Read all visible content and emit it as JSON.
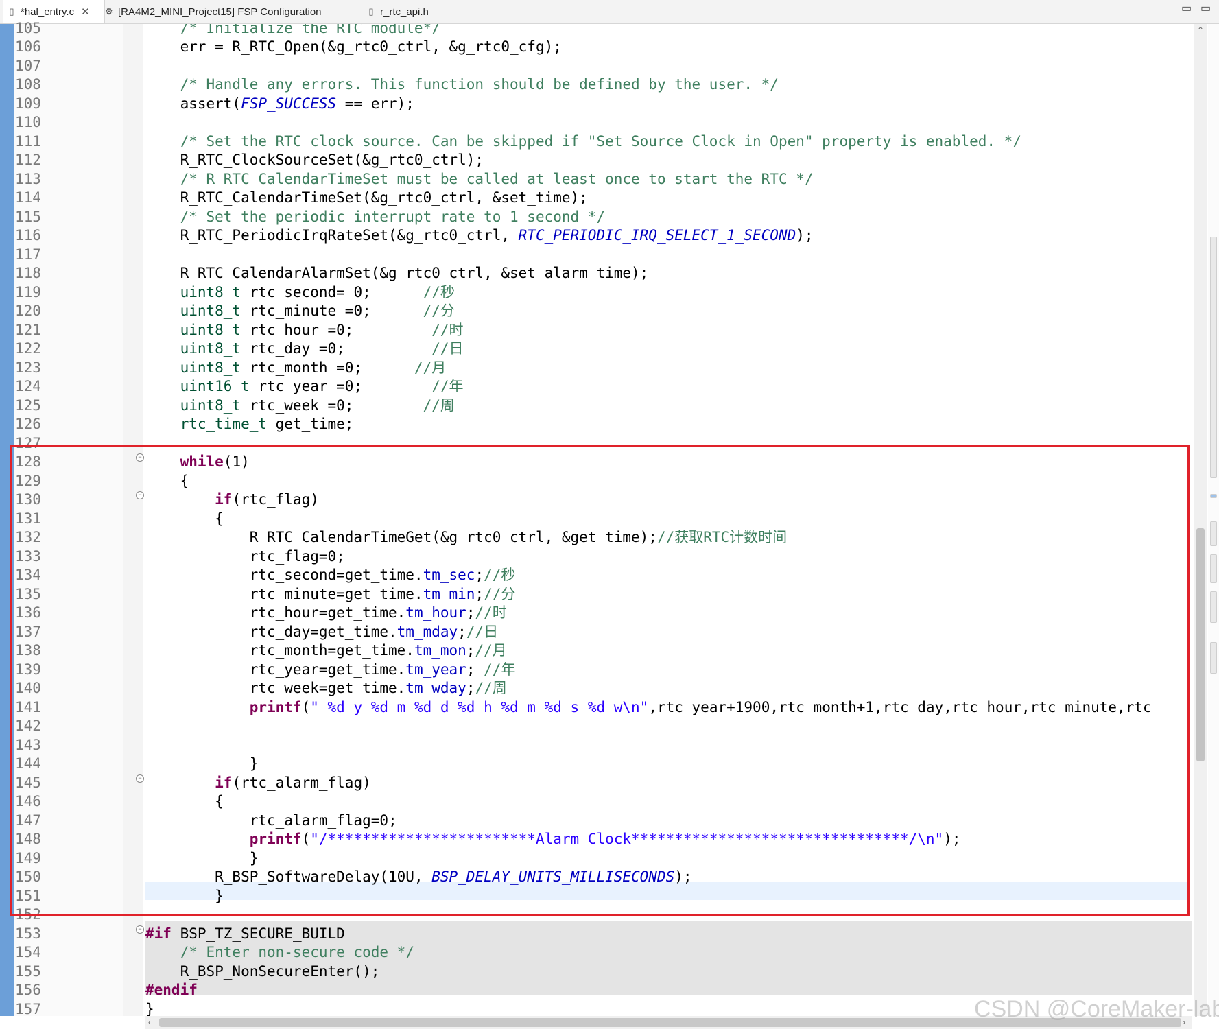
{
  "tabs": [
    {
      "label": "*hal_entry.c",
      "icon": "c-file-icon",
      "active": true
    },
    {
      "label": "[RA4M2_MINI_Project15] FSP Configuration",
      "icon": "gear-icon",
      "active": false
    },
    {
      "label": "r_rtc_api.h",
      "icon": "h-file-icon",
      "active": false
    }
  ],
  "window_controls": {
    "minimize": "▭",
    "maximize": "▭"
  },
  "editor": {
    "line_numbers": [
      "105",
      "106",
      "107",
      "108",
      "109",
      "110",
      "111",
      "112",
      "113",
      "114",
      "115",
      "116",
      "117",
      "118",
      "119",
      "120",
      "121",
      "122",
      "123",
      "124",
      "125",
      "126",
      "127",
      "128",
      "129",
      "130",
      "131",
      "132",
      "133",
      "134",
      "135",
      "136",
      "137",
      "138",
      "139",
      "140",
      "141",
      "142",
      "143",
      "144",
      "145",
      "146",
      "147",
      "148",
      "149",
      "150",
      "151",
      "152",
      "153",
      "154",
      "155",
      "156",
      "157"
    ],
    "lines": [
      [
        [
          "cm",
          "    /* Initialize the RTC module*/"
        ]
      ],
      [
        [
          "",
          "    err = R_RTC_Open(&g_rtc0_ctrl, &g_rtc0_cfg);"
        ]
      ],
      [],
      [
        [
          "cm",
          "    /* Handle any errors. This function should be defined by the user. */"
        ]
      ],
      [
        [
          "",
          "    assert("
        ],
        [
          "mc",
          "FSP_SUCCESS"
        ],
        [
          "",
          " == err);"
        ]
      ],
      [],
      [
        [
          "cm",
          "    /* Set the RTC clock source. Can be skipped if \"Set Source Clock in Open\" property is enabled. */"
        ]
      ],
      [
        [
          "",
          "    R_RTC_ClockSourceSet(&g_rtc0_ctrl);"
        ]
      ],
      [
        [
          "cm",
          "    /* R_RTC_CalendarTimeSet must be called at least once to start the RTC */"
        ]
      ],
      [
        [
          "",
          "    R_RTC_CalendarTimeSet(&g_rtc0_ctrl, &set_time);"
        ]
      ],
      [
        [
          "cm",
          "    /* Set the periodic interrupt rate to 1 second */"
        ]
      ],
      [
        [
          "",
          "    R_RTC_PeriodicIrqRateSet(&g_rtc0_ctrl, "
        ],
        [
          "mc",
          "RTC_PERIODIC_IRQ_SELECT_1_SECOND"
        ],
        [
          "",
          ");"
        ]
      ],
      [],
      [
        [
          "",
          "    R_RTC_CalendarAlarmSet(&g_rtc0_ctrl, &set_alarm_time);"
        ]
      ],
      [
        [
          "ty",
          "    uint8_t"
        ],
        [
          "",
          " rtc_second= 0;      "
        ],
        [
          "cm",
          "//秒"
        ]
      ],
      [
        [
          "ty",
          "    uint8_t"
        ],
        [
          "",
          " rtc_minute =0;      "
        ],
        [
          "cm",
          "//分"
        ]
      ],
      [
        [
          "ty",
          "    uint8_t"
        ],
        [
          "",
          " rtc_hour =0;         "
        ],
        [
          "cm",
          "//时"
        ]
      ],
      [
        [
          "ty",
          "    uint8_t"
        ],
        [
          "",
          " rtc_day =0;          "
        ],
        [
          "cm",
          "//日"
        ]
      ],
      [
        [
          "ty",
          "    uint8_t"
        ],
        [
          "",
          " rtc_month =0;      "
        ],
        [
          "cm",
          "//月"
        ]
      ],
      [
        [
          "ty",
          "    uint16_t"
        ],
        [
          "",
          " rtc_year =0;        "
        ],
        [
          "cm",
          "//年"
        ]
      ],
      [
        [
          "ty",
          "    uint8_t"
        ],
        [
          "",
          " rtc_week =0;        "
        ],
        [
          "cm",
          "//周"
        ]
      ],
      [
        [
          "ty",
          "    rtc_time_t"
        ],
        [
          "",
          " get_time;"
        ]
      ],
      [],
      [
        [
          "kw",
          "    while"
        ],
        [
          "",
          "(1)"
        ]
      ],
      [
        [
          "",
          "    {"
        ]
      ],
      [
        [
          "kw",
          "        if"
        ],
        [
          "",
          "(rtc_flag)"
        ]
      ],
      [
        [
          "",
          "        {"
        ]
      ],
      [
        [
          "",
          "            R_RTC_CalendarTimeGet(&g_rtc0_ctrl, &get_time);"
        ],
        [
          "cm",
          "//获取RTC计数时间"
        ]
      ],
      [
        [
          "",
          "            rtc_flag=0;"
        ]
      ],
      [
        [
          "",
          "            rtc_second=get_time."
        ],
        [
          "fd",
          "tm_sec"
        ],
        [
          "",
          ";"
        ],
        [
          "cm",
          "//秒"
        ]
      ],
      [
        [
          "",
          "            rtc_minute=get_time."
        ],
        [
          "fd",
          "tm_min"
        ],
        [
          "",
          ";"
        ],
        [
          "cm",
          "//分"
        ]
      ],
      [
        [
          "",
          "            rtc_hour=get_time."
        ],
        [
          "fd",
          "tm_hour"
        ],
        [
          "",
          ";"
        ],
        [
          "cm",
          "//时"
        ]
      ],
      [
        [
          "",
          "            rtc_day=get_time."
        ],
        [
          "fd",
          "tm_mday"
        ],
        [
          "",
          ";"
        ],
        [
          "cm",
          "//日"
        ]
      ],
      [
        [
          "",
          "            rtc_month=get_time."
        ],
        [
          "fd",
          "tm_mon"
        ],
        [
          "",
          ";"
        ],
        [
          "cm",
          "//月"
        ]
      ],
      [
        [
          "",
          "            rtc_year=get_time."
        ],
        [
          "fd",
          "tm_year"
        ],
        [
          "",
          "; "
        ],
        [
          "cm",
          "//年"
        ]
      ],
      [
        [
          "",
          "            rtc_week=get_time."
        ],
        [
          "fd",
          "tm_wday"
        ],
        [
          "",
          ";"
        ],
        [
          "cm",
          "//周"
        ]
      ],
      [
        [
          "kw",
          "            printf"
        ],
        [
          "",
          "("
        ],
        [
          "st",
          "\" %d y %d m %d d %d h %d m %d s %d w\\n\""
        ],
        [
          "",
          ",rtc_year+1900,rtc_month+1,rtc_day,rtc_hour,rtc_minute,rtc_"
        ]
      ],
      [],
      [],
      [
        [
          "",
          "            }"
        ]
      ],
      [
        [
          "kw",
          "        if"
        ],
        [
          "",
          "(rtc_alarm_flag)"
        ]
      ],
      [
        [
          "",
          "        {"
        ]
      ],
      [
        [
          "",
          "            rtc_alarm_flag=0;"
        ]
      ],
      [
        [
          "kw",
          "            printf"
        ],
        [
          "",
          "("
        ],
        [
          "st",
          "\"/************************Alarm Clock********************************/\\n\""
        ],
        [
          "",
          ");"
        ]
      ],
      [
        [
          "",
          "            }"
        ]
      ],
      [
        [
          "",
          "        R_BSP_SoftwareDelay(10U, "
        ],
        [
          "mc",
          "BSP_DELAY_UNITS_MILLISECONDS"
        ],
        [
          "",
          ");"
        ]
      ],
      [
        [
          "",
          "        }"
        ]
      ],
      [],
      [
        [
          "kw",
          "#if"
        ],
        [
          "",
          " BSP_TZ_SECURE_BUILD"
        ]
      ],
      [
        [
          "cm",
          "    /* Enter non-secure code */"
        ]
      ],
      [
        [
          "",
          "    R_BSP_NonSecureEnter();"
        ]
      ],
      [
        [
          "kw",
          "#endif"
        ]
      ],
      [
        [
          "",
          "}"
        ]
      ]
    ]
  },
  "watermark": "CSDN @CoreMaker-lab"
}
